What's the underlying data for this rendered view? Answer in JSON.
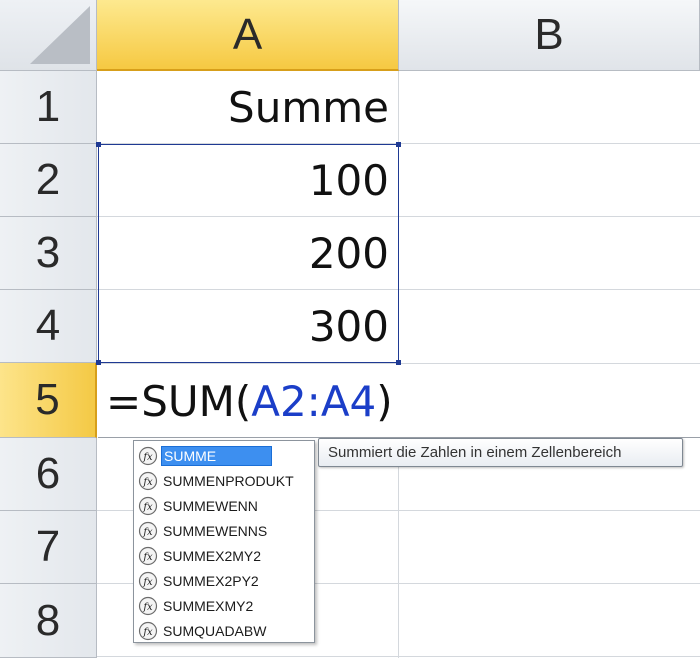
{
  "columns": [
    "A",
    "B"
  ],
  "rows": [
    "1",
    "2",
    "3",
    "4",
    "5",
    "6",
    "7",
    "8"
  ],
  "cells": {
    "A1": "Summe",
    "A2": "100",
    "A3": "200",
    "A4": "300"
  },
  "edit": {
    "prefix": "=SUM(",
    "reference": "A2:A4",
    "suffix": ")"
  },
  "autocomplete": {
    "items": [
      "SUMME",
      "SUMMENPRODUKT",
      "SUMMEWENN",
      "SUMMEWENNS",
      "SUMMEX2MY2",
      "SUMMEX2PY2",
      "SUMMEXMY2",
      "SUMQUADABW"
    ],
    "selected_index": 0,
    "tooltip": "Summiert die Zahlen in einem Zellenbereich"
  },
  "colors": {
    "active_header": "#f6c942",
    "selection_border": "#1f3a93",
    "reference_text": "#1b3ec8",
    "autocomplete_selected": "#3d8ff0"
  },
  "icons": {
    "function": "fx-icon"
  }
}
